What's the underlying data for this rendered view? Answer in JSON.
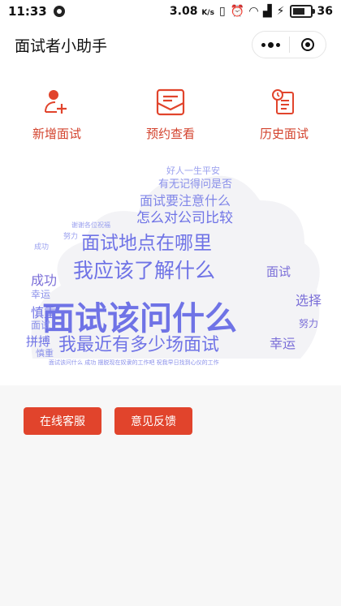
{
  "status": {
    "time": "11:33",
    "speed": "3.08",
    "speed_unit": "K/s",
    "signal": "36"
  },
  "nav": {
    "title": "面试者小助手"
  },
  "menu": {
    "items": [
      {
        "label": "新增面试",
        "icon": "add-user-icon"
      },
      {
        "label": "预约查看",
        "icon": "mail-icon"
      },
      {
        "label": "历史面试",
        "icon": "history-doc-icon"
      }
    ]
  },
  "wordcloud": {
    "words": [
      {
        "text": "面试该问什么"
      },
      {
        "text": "我最近有多少场面试"
      },
      {
        "text": "我应该了解什么"
      },
      {
        "text": "面试地点在哪里"
      },
      {
        "text": "怎么对公司比较"
      },
      {
        "text": "面试要注意什么"
      },
      {
        "text": "有无记得问是否"
      },
      {
        "text": "好人一生平安"
      },
      {
        "text": "选择"
      },
      {
        "text": "幸运"
      },
      {
        "text": "面试"
      },
      {
        "text": "成功"
      },
      {
        "text": "慎重"
      },
      {
        "text": "拼搏"
      },
      {
        "text": "努力"
      },
      {
        "text": "谢谢各位祝福"
      },
      {
        "text": "面试该问什么 成功 摆脱现在奴隶的工作吧 祝我早日找到心仪的工作"
      }
    ],
    "colors": {
      "primary": "#6f73e6",
      "secondary": "#9aa0ef",
      "dark": "#7b6fd8"
    }
  },
  "actions": {
    "service": "在线客服",
    "feedback": "意见反馈"
  },
  "theme": {
    "accent": "#e1442c"
  }
}
